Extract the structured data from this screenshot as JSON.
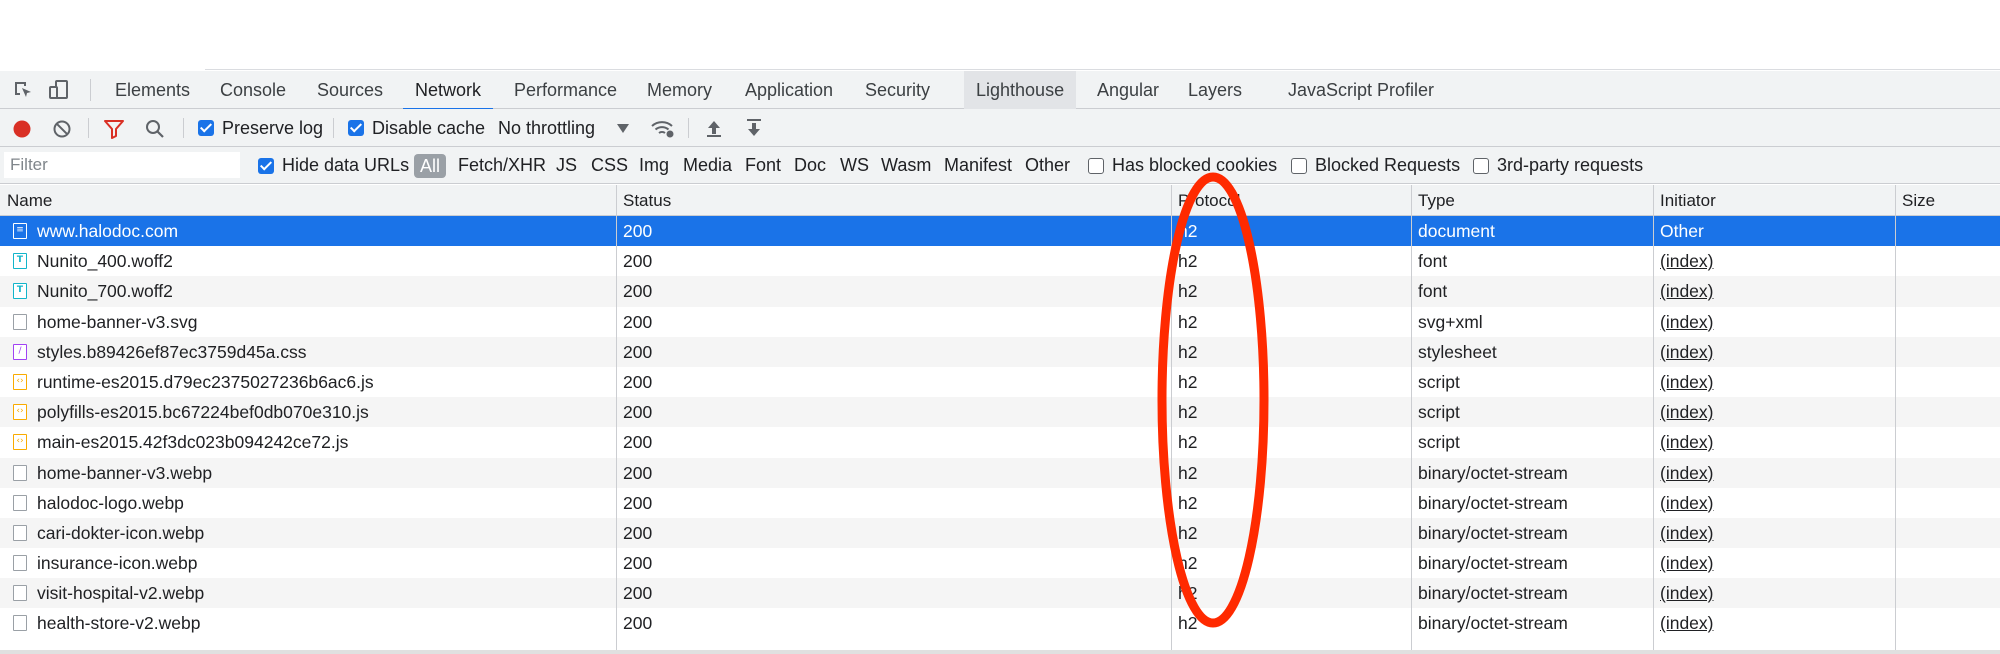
{
  "tabs": [
    {
      "label": "Elements",
      "active": false
    },
    {
      "label": "Console",
      "active": false
    },
    {
      "label": "Sources",
      "active": false
    },
    {
      "label": "Network",
      "active": true
    },
    {
      "label": "Performance",
      "active": false
    },
    {
      "label": "Memory",
      "active": false
    },
    {
      "label": "Application",
      "active": false
    },
    {
      "label": "Security",
      "active": false
    },
    {
      "label": "Lighthouse",
      "active": false
    },
    {
      "label": "Angular",
      "active": false
    },
    {
      "label": "Layers",
      "active": false
    },
    {
      "label": "JavaScript Profiler",
      "active": false
    }
  ],
  "toolbar": {
    "preserve_log_label": "Preserve log",
    "preserve_log_checked": true,
    "disable_cache_label": "Disable cache",
    "disable_cache_checked": true,
    "throttling_value": "No throttling"
  },
  "filterbar": {
    "filter_placeholder": "Filter",
    "hide_data_urls_label": "Hide data URLs",
    "hide_data_urls_checked": true,
    "types": [
      "All",
      "Fetch/XHR",
      "JS",
      "CSS",
      "Img",
      "Media",
      "Font",
      "Doc",
      "WS",
      "Wasm",
      "Manifest",
      "Other"
    ],
    "has_blocked_cookies_label": "Has blocked cookies",
    "blocked_requests_label": "Blocked Requests",
    "third_party_label": "3rd-party requests"
  },
  "table": {
    "columns": [
      "Name",
      "Status",
      "Protocol",
      "Type",
      "Initiator",
      "Size"
    ],
    "rows": [
      {
        "icon": "document-icon",
        "name": "www.halodoc.com",
        "status": "200",
        "protocol": "h2",
        "type": "document",
        "initiator": "Other",
        "selected": true
      },
      {
        "icon": "font-icon",
        "name": "Nunito_400.woff2",
        "status": "200",
        "protocol": "h2",
        "type": "font",
        "initiator": "(index)"
      },
      {
        "icon": "font-icon",
        "name": "Nunito_700.woff2",
        "status": "200",
        "protocol": "h2",
        "type": "font",
        "initiator": "(index)"
      },
      {
        "icon": "image-icon",
        "name": "home-banner-v3.svg",
        "status": "200",
        "protocol": "h2",
        "type": "svg+xml",
        "initiator": "(index)"
      },
      {
        "icon": "stylesheet-icon",
        "name": "styles.b89426ef87ec3759d45a.css",
        "status": "200",
        "protocol": "h2",
        "type": "stylesheet",
        "initiator": "(index)"
      },
      {
        "icon": "script-icon",
        "name": "runtime-es2015.d79ec2375027236b6ac6.js",
        "status": "200",
        "protocol": "h2",
        "type": "script",
        "initiator": "(index)"
      },
      {
        "icon": "script-icon",
        "name": "polyfills-es2015.bc67224bef0db070e310.js",
        "status": "200",
        "protocol": "h2",
        "type": "script",
        "initiator": "(index)"
      },
      {
        "icon": "script-icon",
        "name": "main-es2015.42f3dc023b094242ce72.js",
        "status": "200",
        "protocol": "h2",
        "type": "script",
        "initiator": "(index)"
      },
      {
        "icon": "image-icon",
        "name": "home-banner-v3.webp",
        "status": "200",
        "protocol": "h2",
        "type": "binary/octet-stream",
        "initiator": "(index)"
      },
      {
        "icon": "image-icon",
        "name": "halodoc-logo.webp",
        "status": "200",
        "protocol": "h2",
        "type": "binary/octet-stream",
        "initiator": "(index)"
      },
      {
        "icon": "image-icon",
        "name": "cari-dokter-icon.webp",
        "status": "200",
        "protocol": "h2",
        "type": "binary/octet-stream",
        "initiator": "(index)"
      },
      {
        "icon": "image-icon",
        "name": "insurance-icon.webp",
        "status": "200",
        "protocol": "h2",
        "type": "binary/octet-stream",
        "initiator": "(index)"
      },
      {
        "icon": "image-icon",
        "name": "visit-hospital-v2.webp",
        "status": "200",
        "protocol": "h2",
        "type": "binary/octet-stream",
        "initiator": "(index)"
      },
      {
        "icon": "image-icon",
        "name": "health-store-v2.webp",
        "status": "200",
        "protocol": "h2",
        "type": "binary/octet-stream",
        "initiator": "(index)"
      }
    ]
  },
  "annotation": {
    "shape": "ellipse",
    "color": "#ff2a00",
    "target": "Protocol column"
  },
  "colors": {
    "accent": "#1a73e8",
    "record": "#d93025",
    "filter": "#d93025"
  }
}
